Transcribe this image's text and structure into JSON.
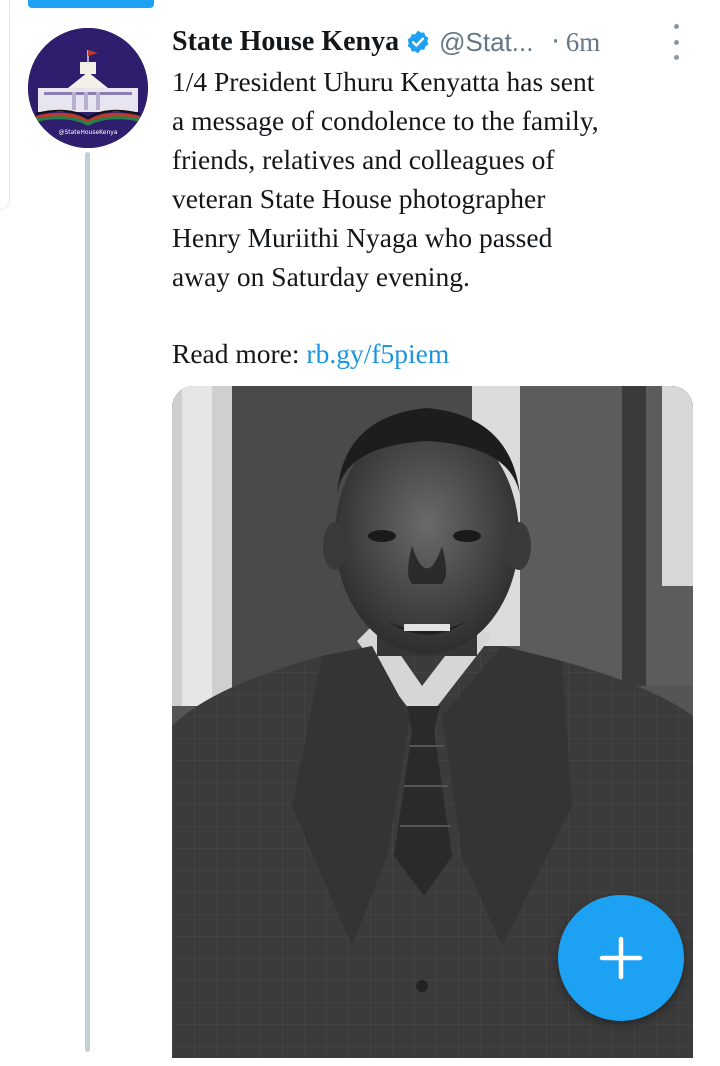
{
  "tweet": {
    "author_name": "State House Kenya",
    "handle": "@Stat...",
    "separator": "·",
    "time": "6m",
    "text_lines": [
      "1/4 President Uhuru Kenyatta has sent",
      "a message of condolence to the family,",
      "friends, relatives and colleagues of",
      "veteran State House photographer",
      "Henry Muriithi Nyaga who passed",
      "away on Saturday evening."
    ],
    "read_more_label": "Read more:",
    "read_more_link": "rb.gy/f5piem"
  },
  "avatar": {
    "caption": "@StateHouseKenya"
  },
  "icons": {
    "verified": "verified-badge-icon",
    "more": "more-vertical-icon",
    "compose": "plus-icon"
  },
  "colors": {
    "accent": "#1da1f2",
    "link": "#1b95e0",
    "muted": "#657786",
    "avatar_bg": "#2f1d6e"
  }
}
